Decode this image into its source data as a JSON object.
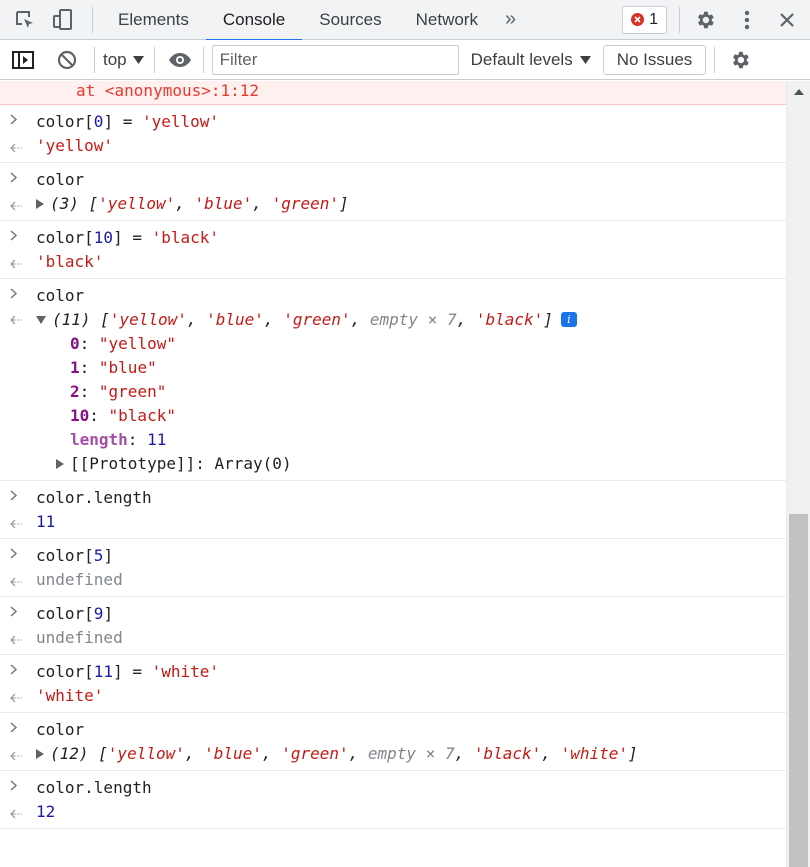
{
  "tabs": [
    "Elements",
    "Console",
    "Sources",
    "Network"
  ],
  "active_tab": "Console",
  "more_tabs": "»",
  "error_count": "1",
  "toolbar": {
    "context": "top",
    "filter_placeholder": "Filter",
    "levels": "Default levels",
    "issues": "No Issues"
  },
  "colors": {
    "accent": "#1a73e8",
    "error": "#d93025",
    "string": "#c41a16",
    "number": "#1a1aa6"
  },
  "console": {
    "error_tail": "at <anonymous>:1:12",
    "entries": [
      {
        "input": "color[0] = 'yellow'",
        "output": "'yellow'"
      },
      {
        "input": "color",
        "output": "(3) ['yellow', 'blue', 'green']"
      },
      {
        "input": "color[10] = 'black'",
        "output": "'black'"
      },
      {
        "input": "color",
        "output": "(11) ['yellow', 'blue', 'green', empty × 7, 'black']",
        "expanded": [
          {
            "key": "0",
            "value": "\"yellow\""
          },
          {
            "key": "1",
            "value": "\"blue\""
          },
          {
            "key": "2",
            "value": "\"green\""
          },
          {
            "key": "10",
            "value": "\"black\""
          },
          {
            "key": "length",
            "value": "11"
          }
        ],
        "prototype": "[[Prototype]]: Array(0)"
      },
      {
        "input": "color.length",
        "output": "11"
      },
      {
        "input": "color[5]",
        "output": "undefined"
      },
      {
        "input": "color[9]",
        "output": "undefined"
      },
      {
        "input": "color[11] = 'white'",
        "output": "'white'"
      },
      {
        "input": "color",
        "output": "(12) ['yellow', 'blue', 'green', empty × 7, 'black', 'white']"
      },
      {
        "input": "color.length",
        "output": "12"
      }
    ]
  }
}
